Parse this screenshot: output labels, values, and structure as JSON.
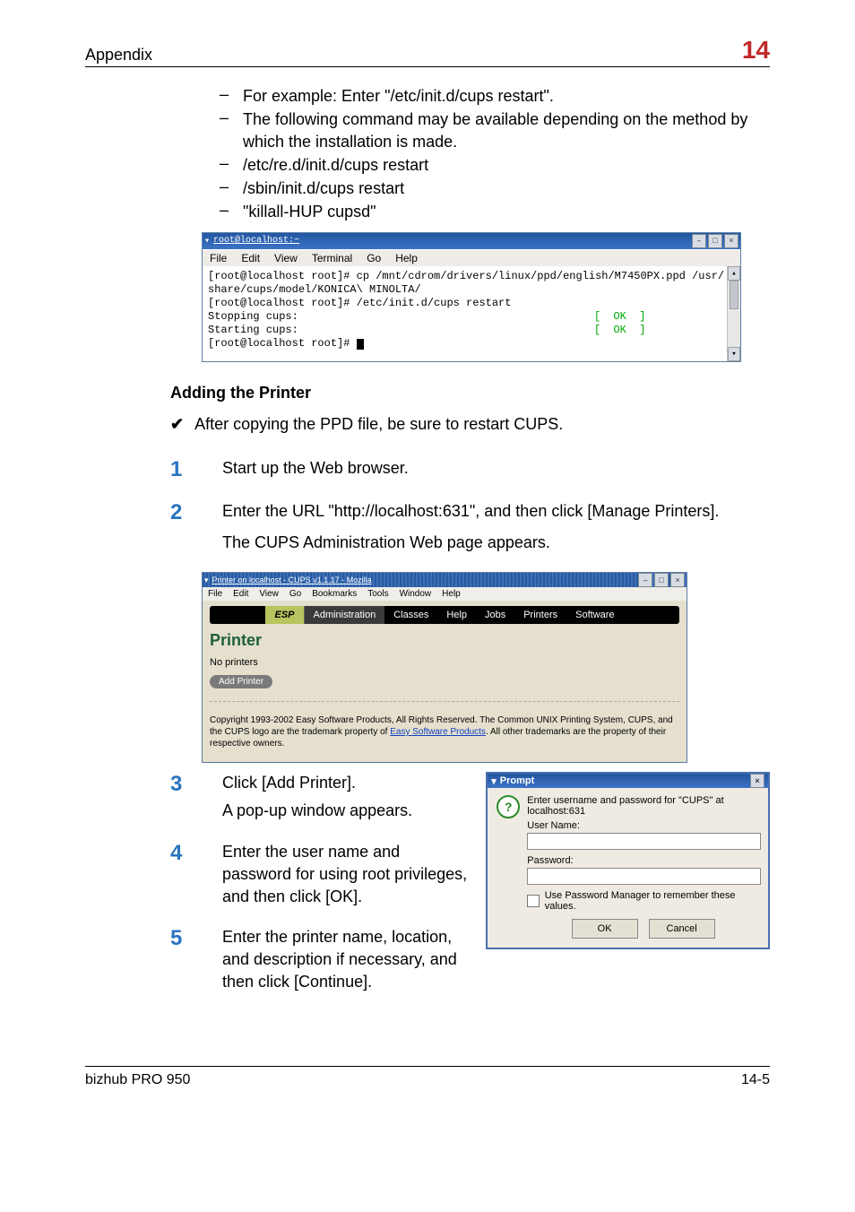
{
  "header": {
    "left": "Appendix",
    "right": "14"
  },
  "bullets": {
    "b1": "For example: Enter \"/etc/init.d/cups restart\".",
    "b2": "The following command may be available depending on the method by which the installation is made.",
    "b3": "/etc/re.d/init.d/cups restart",
    "b4": "/sbin/init.d/cups restart",
    "b5": "\"killall-HUP cupsd\""
  },
  "terminal": {
    "title": "root@localhost:~",
    "menus": {
      "file": "File",
      "edit": "Edit",
      "view": "View",
      "terminal": "Terminal",
      "go": "Go",
      "help": "Help"
    },
    "l1": "[root@localhost root]# cp /mnt/cdrom/drivers/linux/ppd/english/M7450PX.ppd /usr/",
    "l2": "share/cups/model/KONICA\\ MINOLTA/",
    "l3": "[root@localhost root]# /etc/init.d/cups restart",
    "l4a": "Stopping cups:",
    "l4ok": "[  OK  ]",
    "l5a": "Starting cups:",
    "l5ok": "[  OK  ]",
    "l6": "[root@localhost root]# "
  },
  "section_title": "Adding the Printer",
  "check_line": "After copying the PPD file, be sure to restart CUPS.",
  "steps": {
    "s1": "Start up the Web browser.",
    "s2a": "Enter the URL \"http://localhost:631\", and then click [Manage Printers].",
    "s2b": "The CUPS Administration Web page appears.",
    "s3a": "Click [Add Printer].",
    "s3b": "A pop-up window appears.",
    "s4": "Enter the user name and password for using root privileges, and then click [OK].",
    "s5": "Enter the printer name, location, and description if necessary, and then click [Continue]."
  },
  "browser": {
    "title": "Printer on localhost - CUPS v1.1.17 - Mozilla",
    "menus": {
      "file": "File",
      "edit": "Edit",
      "view": "View",
      "go": "Go",
      "bookmarks": "Bookmarks",
      "tools": "Tools",
      "window": "Window",
      "help": "Help"
    },
    "tabs": {
      "esp": "ESP",
      "admin": "Administration",
      "classes": "Classes",
      "help": "Help",
      "jobs": "Jobs",
      "printers": "Printers",
      "software": "Software"
    },
    "heading": "Printer",
    "no_printers": "No printers",
    "add_printer": "Add Printer",
    "copyright_a": "Copyright 1993-2002 Easy Software Products, All Rights Reserved. The Common UNIX Printing System, CUPS, and the CUPS logo are the trademark property of ",
    "copyright_link": "Easy Software Products",
    "copyright_b": ". All other trademarks are the property of their respective owners."
  },
  "prompt": {
    "title": "Prompt",
    "msg": "Enter username and password for \"CUPS\" at localhost:631",
    "user_label": "User Name:",
    "pass_label": "Password:",
    "remember": "Use Password Manager to remember these values.",
    "ok": "OK",
    "cancel": "Cancel"
  },
  "footer": {
    "left": "bizhub PRO 950",
    "right": "14-5"
  }
}
